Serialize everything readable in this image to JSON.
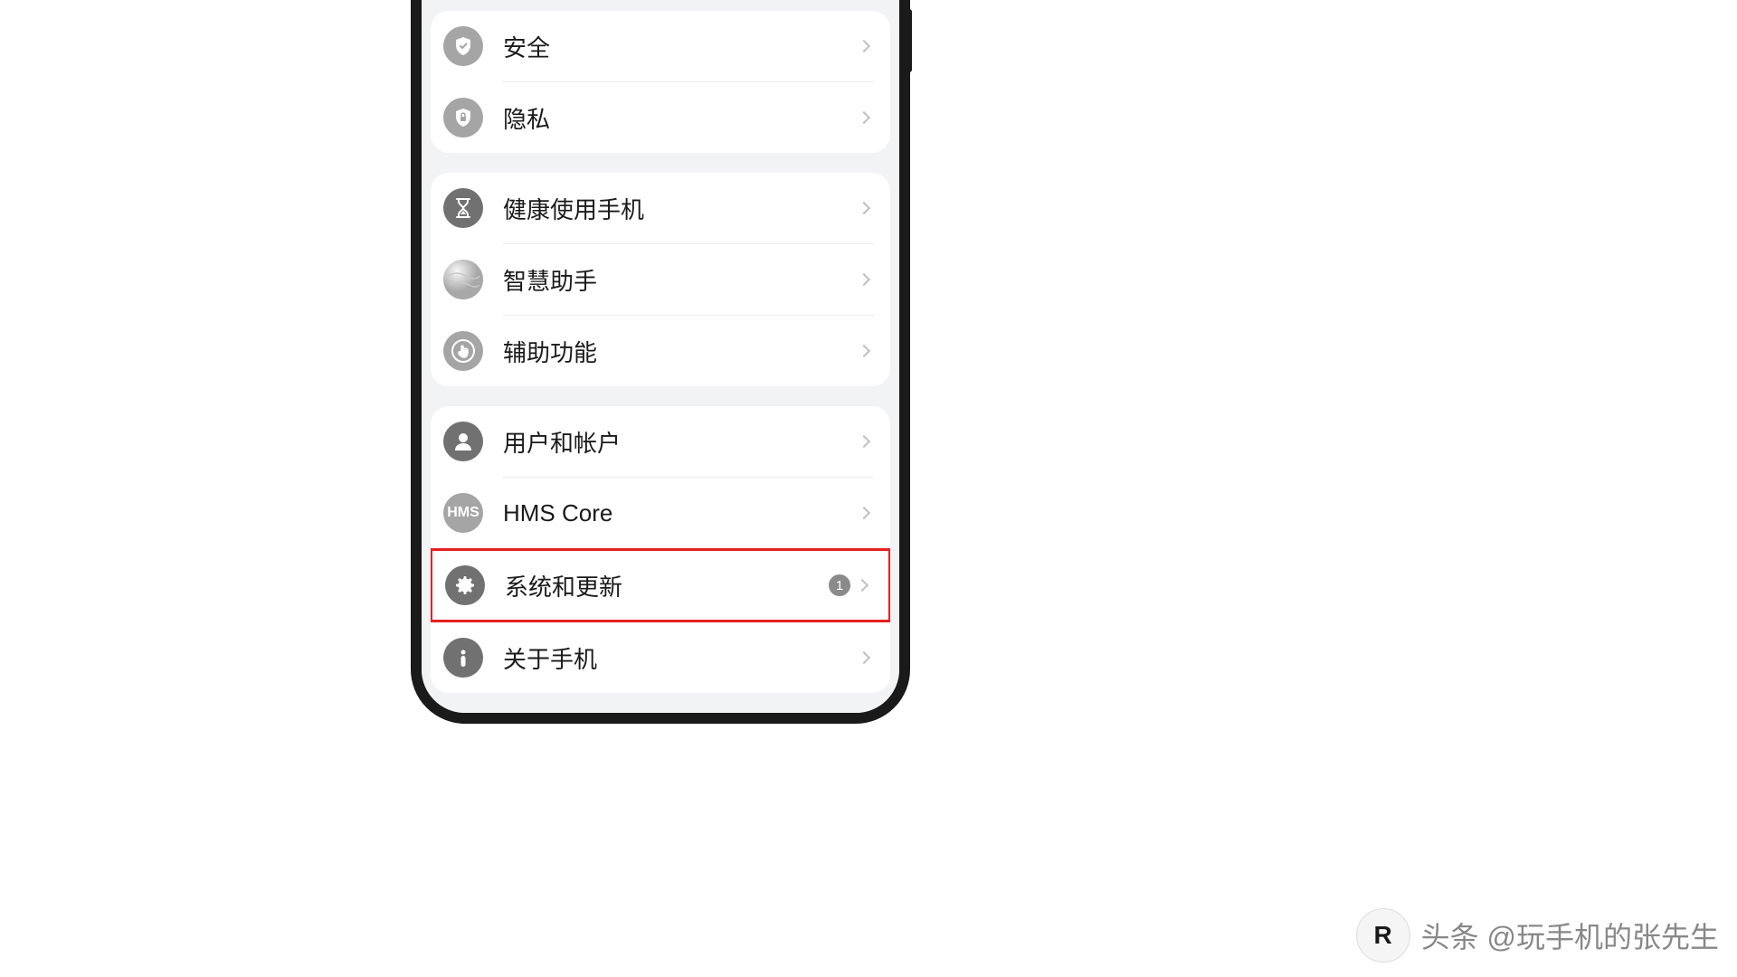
{
  "groups": [
    {
      "items": [
        {
          "key": "security",
          "label": "安全",
          "icon": "shield"
        },
        {
          "key": "privacy",
          "label": "隐私",
          "icon": "lock-shield"
        }
      ]
    },
    {
      "items": [
        {
          "key": "digital-wellbeing",
          "label": "健康使用手机",
          "icon": "hourglass"
        },
        {
          "key": "ai-assistant",
          "label": "智慧助手",
          "icon": "globe"
        },
        {
          "key": "accessibility",
          "label": "辅助功能",
          "icon": "tap"
        }
      ]
    },
    {
      "items": [
        {
          "key": "users-accounts",
          "label": "用户和帐户",
          "icon": "person"
        },
        {
          "key": "hms-core",
          "label": "HMS Core",
          "icon": "hms-text"
        },
        {
          "key": "system-update",
          "label": "系统和更新",
          "icon": "gear",
          "badge": "1",
          "highlighted": true
        },
        {
          "key": "about-phone",
          "label": "关于手机",
          "icon": "info"
        }
      ]
    }
  ],
  "watermark": {
    "logo": "R",
    "text": "头条 @玩手机的张先生"
  },
  "highlight_color": "#e62020"
}
